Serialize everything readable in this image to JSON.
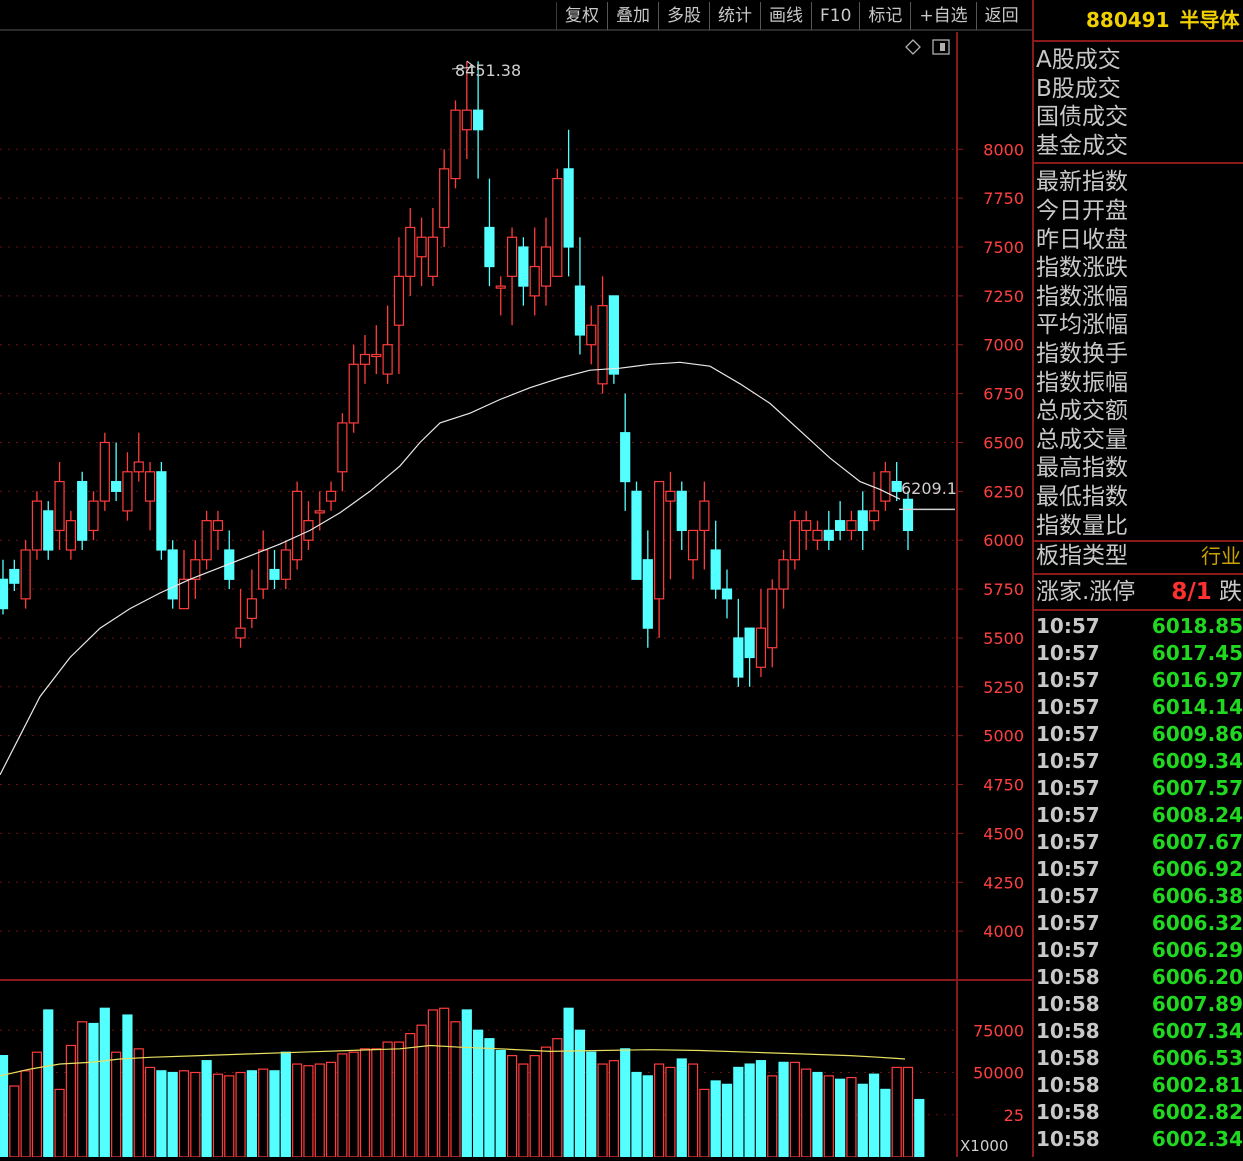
{
  "toolbar": [
    "复权",
    "叠加",
    "多股",
    "统计",
    "画线",
    "F10",
    "标记",
    "+自选",
    "返回"
  ],
  "header": {
    "code": "880491",
    "name": "半导体"
  },
  "right_panel": {
    "group1": [
      "A股成交",
      "B股成交",
      "国债成交",
      "基金成交"
    ],
    "group2": [
      "最新指数",
      "今日开盘",
      "昨日收盘",
      "指数涨跌",
      "指数涨幅",
      "平均涨幅",
      "指数换手",
      "指数振幅",
      "总成交额",
      "总成交量",
      "最高指数",
      "最低指数",
      "指数量比"
    ],
    "board_type_label": "板指类型",
    "board_type_value": "行业",
    "up_limit_label": "涨家.涨停",
    "up_limit_value": "8/1",
    "down_label": "跌家",
    "ticks": [
      {
        "time": "10:57",
        "price": "6018.85"
      },
      {
        "time": "10:57",
        "price": "6017.45"
      },
      {
        "time": "10:57",
        "price": "6016.97"
      },
      {
        "time": "10:57",
        "price": "6014.14"
      },
      {
        "time": "10:57",
        "price": "6009.86"
      },
      {
        "time": "10:57",
        "price": "6009.34"
      },
      {
        "time": "10:57",
        "price": "6007.57"
      },
      {
        "time": "10:57",
        "price": "6008.24"
      },
      {
        "time": "10:57",
        "price": "6007.67"
      },
      {
        "time": "10:57",
        "price": "6006.92"
      },
      {
        "time": "10:57",
        "price": "6006.38"
      },
      {
        "time": "10:57",
        "price": "6006.32"
      },
      {
        "time": "10:57",
        "price": "6006.29"
      },
      {
        "time": "10:58",
        "price": "6006.20"
      },
      {
        "time": "10:58",
        "price": "6007.89"
      },
      {
        "time": "10:58",
        "price": "6007.34"
      },
      {
        "time": "10:58",
        "price": "6006.53"
      },
      {
        "time": "10:58",
        "price": "6002.81"
      },
      {
        "time": "10:58",
        "price": "6002.82"
      },
      {
        "time": "10:58",
        "price": "6002.34"
      }
    ]
  },
  "colors": {
    "up": "#ff3c3c",
    "down": "#54ffff",
    "ma": "#e8e8e8",
    "vol_ma": "#e8e060",
    "axis": "#8a1a1a",
    "grid": "#6a1010"
  },
  "chart_data": {
    "type": "candlestick",
    "y_axis_ticks": [
      4000,
      4250,
      4500,
      4750,
      5000,
      5250,
      5500,
      5750,
      6000,
      6250,
      6500,
      6750,
      7000,
      7250,
      7500,
      7750,
      8000
    ],
    "ylim": [
      3750,
      8600
    ],
    "high_label": "8451.38",
    "last_label": "6209.1",
    "volume_axis_ticks": [
      "75000",
      "50000",
      "25"
    ],
    "volume_unit": "X1000",
    "volume_ylim": [
      0,
      100000
    ],
    "candles": [
      [
        5800,
        5650,
        5900,
        5620
      ],
      [
        5850,
        5780,
        5900,
        5740
      ],
      [
        5700,
        5950,
        6000,
        5650
      ],
      [
        5950,
        6200,
        6250,
        5900
      ],
      [
        6150,
        5950,
        6200,
        5900
      ],
      [
        6050,
        6300,
        6400,
        5950
      ],
      [
        5950,
        6100,
        6150,
        5900
      ],
      [
        6300,
        6000,
        6350,
        5950
      ],
      [
        6050,
        6200,
        6250,
        6000
      ],
      [
        6200,
        6500,
        6550,
        6150
      ],
      [
        6300,
        6250,
        6500,
        6200
      ],
      [
        6150,
        6350,
        6450,
        6100
      ],
      [
        6350,
        6400,
        6550,
        6300
      ],
      [
        6200,
        6350,
        6400,
        6050
      ],
      [
        6350,
        5950,
        6400,
        5900
      ],
      [
        5950,
        5700,
        6000,
        5650
      ],
      [
        5650,
        5800,
        5950,
        5650
      ],
      [
        5800,
        5900,
        6000,
        5700
      ],
      [
        5900,
        6100,
        6150,
        5850
      ],
      [
        6050,
        6100,
        6150,
        5950
      ],
      [
        5950,
        5800,
        6050,
        5750
      ],
      [
        5500,
        5550,
        5750,
        5450
      ],
      [
        5600,
        5700,
        5850,
        5550
      ],
      [
        5750,
        5950,
        6050,
        5700
      ],
      [
        5850,
        5800,
        5950,
        5750
      ],
      [
        5800,
        5950,
        6000,
        5750
      ],
      [
        5900,
        6250,
        6300,
        5850
      ],
      [
        6000,
        6100,
        6200,
        5950
      ],
      [
        6150,
        6150,
        6250,
        6050
      ],
      [
        6200,
        6250,
        6300,
        6150
      ],
      [
        6350,
        6600,
        6650,
        6250
      ],
      [
        6600,
        6900,
        7000,
        6550
      ],
      [
        6900,
        6950,
        7050,
        6800
      ],
      [
        6950,
        6950,
        7100,
        6850
      ],
      [
        6850,
        7000,
        7200,
        6800
      ],
      [
        7100,
        7350,
        7550,
        6850
      ],
      [
        7350,
        7600,
        7700,
        7250
      ],
      [
        7450,
        7550,
        7650,
        7300
      ],
      [
        7350,
        7550,
        7700,
        7300
      ],
      [
        7600,
        7900,
        8000,
        7500
      ],
      [
        7850,
        8200,
        8250,
        7800
      ],
      [
        8100,
        8200,
        8450,
        7950
      ],
      [
        8200,
        8100,
        8450,
        7850
      ],
      [
        7600,
        7400,
        7850,
        7300
      ],
      [
        7300,
        7300,
        7350,
        7150
      ],
      [
        7350,
        7550,
        7600,
        7100
      ],
      [
        7500,
        7300,
        7550,
        7200
      ],
      [
        7250,
        7400,
        7600,
        7150
      ],
      [
        7300,
        7500,
        7650,
        7200
      ],
      [
        7350,
        7850,
        7900,
        7350
      ],
      [
        7900,
        7500,
        8100,
        7350
      ],
      [
        7300,
        7050,
        7550,
        6950
      ],
      [
        7000,
        7100,
        7200,
        6900
      ],
      [
        6800,
        7200,
        7350,
        6750
      ],
      [
        7250,
        6850,
        7250,
        6800
      ],
      [
        6550,
        6300,
        6750,
        6150
      ],
      [
        6250,
        5800,
        6300,
        5800
      ],
      [
        5900,
        5550,
        6050,
        5450
      ],
      [
        5700,
        6300,
        6300,
        5500
      ],
      [
        6200,
        6250,
        6350,
        5800
      ],
      [
        6250,
        6050,
        6300,
        5950
      ],
      [
        5900,
        6050,
        6050,
        5800
      ],
      [
        6050,
        6200,
        6300,
        5850
      ],
      [
        5950,
        5750,
        6100,
        5700
      ],
      [
        5750,
        5700,
        5850,
        5600
      ],
      [
        5500,
        5300,
        5700,
        5250
      ],
      [
        5550,
        5400,
        5550,
        5250
      ],
      [
        5350,
        5550,
        5750,
        5300
      ],
      [
        5450,
        5750,
        5800,
        5350
      ],
      [
        5750,
        5900,
        5950,
        5650
      ],
      [
        5900,
        6100,
        6150,
        5850
      ],
      [
        6050,
        6100,
        6150,
        5950
      ],
      [
        6000,
        6050,
        6100,
        5950
      ],
      [
        6050,
        6000,
        6150,
        5950
      ],
      [
        6100,
        6050,
        6200,
        6000
      ],
      [
        6050,
        6100,
        6150,
        6000
      ],
      [
        6150,
        6050,
        6250,
        5950
      ],
      [
        6100,
        6150,
        6350,
        6050
      ],
      [
        6200,
        6350,
        6400,
        6150
      ],
      [
        6300,
        6250,
        6400,
        6200
      ],
      [
        6209.1,
        6050,
        6250,
        5950
      ]
    ],
    "volumes": [
      [
        60000,
        "down"
      ],
      [
        42000,
        "up"
      ],
      [
        51000,
        "up"
      ],
      [
        62000,
        "up"
      ],
      [
        87000,
        "down"
      ],
      [
        40000,
        "up"
      ],
      [
        66000,
        "up"
      ],
      [
        80000,
        "up"
      ],
      [
        79000,
        "down"
      ],
      [
        88000,
        "down"
      ],
      [
        62000,
        "up"
      ],
      [
        84000,
        "down"
      ],
      [
        64000,
        "up"
      ],
      [
        53000,
        "up"
      ],
      [
        51000,
        "down"
      ],
      [
        50000,
        "down"
      ],
      [
        51000,
        "up"
      ],
      [
        50000,
        "up"
      ],
      [
        57000,
        "down"
      ],
      [
        49000,
        "up"
      ],
      [
        48000,
        "up"
      ],
      [
        50000,
        "up"
      ],
      [
        51000,
        "down"
      ],
      [
        52000,
        "up"
      ],
      [
        51000,
        "down"
      ],
      [
        62000,
        "down"
      ],
      [
        55000,
        "up"
      ],
      [
        54000,
        "up"
      ],
      [
        55000,
        "up"
      ],
      [
        56000,
        "up"
      ],
      [
        61000,
        "up"
      ],
      [
        62000,
        "up"
      ],
      [
        64000,
        "up"
      ],
      [
        64000,
        "up"
      ],
      [
        68000,
        "up"
      ],
      [
        68000,
        "up"
      ],
      [
        73000,
        "up"
      ],
      [
        78000,
        "up"
      ],
      [
        87000,
        "up"
      ],
      [
        88000,
        "up"
      ],
      [
        80000,
        "up"
      ],
      [
        87000,
        "down"
      ],
      [
        75000,
        "down"
      ],
      [
        70000,
        "down"
      ],
      [
        63000,
        "down"
      ],
      [
        60000,
        "up"
      ],
      [
        55000,
        "up"
      ],
      [
        60000,
        "up"
      ],
      [
        65000,
        "up"
      ],
      [
        70000,
        "up"
      ],
      [
        88000,
        "down"
      ],
      [
        75000,
        "down"
      ],
      [
        62000,
        "down"
      ],
      [
        55000,
        "up"
      ],
      [
        57000,
        "up"
      ],
      [
        64000,
        "down"
      ],
      [
        50000,
        "down"
      ],
      [
        48000,
        "down"
      ],
      [
        55000,
        "up"
      ],
      [
        53000,
        "up"
      ],
      [
        58000,
        "down"
      ],
      [
        55000,
        "up"
      ],
      [
        40000,
        "up"
      ],
      [
        45000,
        "down"
      ],
      [
        43000,
        "down"
      ],
      [
        53000,
        "down"
      ],
      [
        55000,
        "down"
      ],
      [
        57000,
        "down"
      ],
      [
        48000,
        "up"
      ],
      [
        56000,
        "down"
      ],
      [
        56000,
        "up"
      ],
      [
        52000,
        "up"
      ],
      [
        50000,
        "down"
      ],
      [
        48000,
        "up"
      ],
      [
        46000,
        "down"
      ],
      [
        47000,
        "up"
      ],
      [
        43000,
        "down"
      ],
      [
        49000,
        "down"
      ],
      [
        40000,
        "down"
      ],
      [
        53000,
        "up"
      ],
      [
        53000,
        "up"
      ],
      [
        34000,
        "down"
      ]
    ],
    "ma_line": [
      [
        0,
        4800
      ],
      [
        20,
        5000
      ],
      [
        40,
        5200
      ],
      [
        70,
        5400
      ],
      [
        100,
        5550
      ],
      [
        130,
        5650
      ],
      [
        160,
        5730
      ],
      [
        190,
        5800
      ],
      [
        220,
        5860
      ],
      [
        250,
        5920
      ],
      [
        280,
        5980
      ],
      [
        310,
        6050
      ],
      [
        340,
        6140
      ],
      [
        370,
        6250
      ],
      [
        400,
        6380
      ],
      [
        420,
        6500
      ],
      [
        440,
        6600
      ],
      [
        470,
        6650
      ],
      [
        500,
        6720
      ],
      [
        530,
        6780
      ],
      [
        560,
        6830
      ],
      [
        590,
        6870
      ],
      [
        620,
        6880
      ],
      [
        650,
        6900
      ],
      [
        680,
        6910
      ],
      [
        710,
        6890
      ],
      [
        740,
        6800
      ],
      [
        770,
        6700
      ],
      [
        800,
        6560
      ],
      [
        830,
        6420
      ],
      [
        860,
        6300
      ],
      [
        880,
        6260
      ],
      [
        900,
        6210
      ]
    ],
    "vol_ma_line": [
      [
        0,
        48000
      ],
      [
        30,
        52000
      ],
      [
        60,
        55000
      ],
      [
        90,
        56000
      ],
      [
        120,
        58000
      ],
      [
        150,
        59000
      ],
      [
        200,
        60000
      ],
      [
        250,
        61000
      ],
      [
        300,
        62000
      ],
      [
        350,
        63000
      ],
      [
        400,
        64000
      ],
      [
        430,
        66000
      ],
      [
        460,
        65000
      ],
      [
        500,
        64000
      ],
      [
        550,
        62500
      ],
      [
        600,
        63000
      ],
      [
        650,
        63500
      ],
      [
        700,
        63000
      ],
      [
        750,
        62000
      ],
      [
        800,
        61000
      ],
      [
        850,
        60000
      ],
      [
        880,
        59000
      ],
      [
        905,
        58000
      ]
    ]
  }
}
